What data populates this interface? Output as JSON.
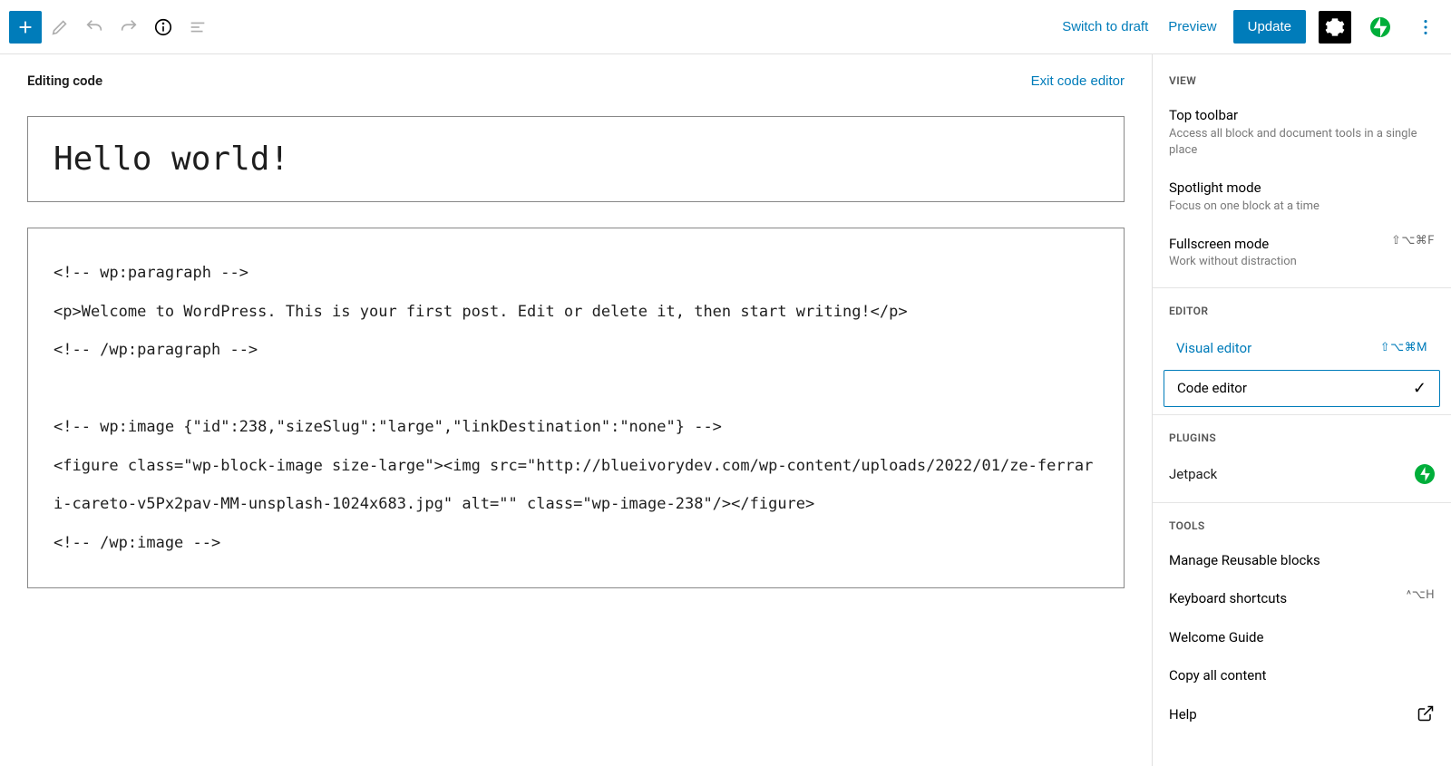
{
  "topbar": {
    "switch_to_draft": "Switch to draft",
    "preview": "Preview",
    "update": "Update"
  },
  "editor": {
    "heading": "Editing code",
    "exit_label": "Exit code editor",
    "title": "Hello world!",
    "code": "<!-- wp:paragraph -->\n<p>Welcome to WordPress. This is your first post. Edit or delete it, then start writing!</p>\n<!-- /wp:paragraph -->\n\n<!-- wp:image {\"id\":238,\"sizeSlug\":\"large\",\"linkDestination\":\"none\"} -->\n<figure class=\"wp-block-image size-large\"><img src=\"http://blueivorydev.com/wp-content/uploads/2022/01/ze-ferrari-careto-v5Px2pav-MM-unsplash-1024x683.jpg\" alt=\"\" class=\"wp-image-238\"/></figure>\n<!-- /wp:image -->"
  },
  "sidebar": {
    "sections": {
      "view": "VIEW",
      "editor": "EDITOR",
      "plugins": "PLUGINS",
      "tools": "TOOLS"
    },
    "view_items": [
      {
        "label": "Top toolbar",
        "desc": "Access all block and document tools in a single place"
      },
      {
        "label": "Spotlight mode",
        "desc": "Focus on one block at a time"
      },
      {
        "label": "Fullscreen mode",
        "desc": "Work without distraction",
        "shortcut": "⇧⌥⌘F"
      }
    ],
    "editor_items": {
      "visual": "Visual editor",
      "visual_shortcut": "⇧⌥⌘M",
      "code": "Code editor"
    },
    "plugins": {
      "jetpack": "Jetpack"
    },
    "tools": [
      {
        "label": "Manage Reusable blocks"
      },
      {
        "label": "Keyboard shortcuts",
        "shortcut": "^⌥H"
      },
      {
        "label": "Welcome Guide"
      },
      {
        "label": "Copy all content"
      },
      {
        "label": "Help",
        "ext": true
      }
    ]
  }
}
